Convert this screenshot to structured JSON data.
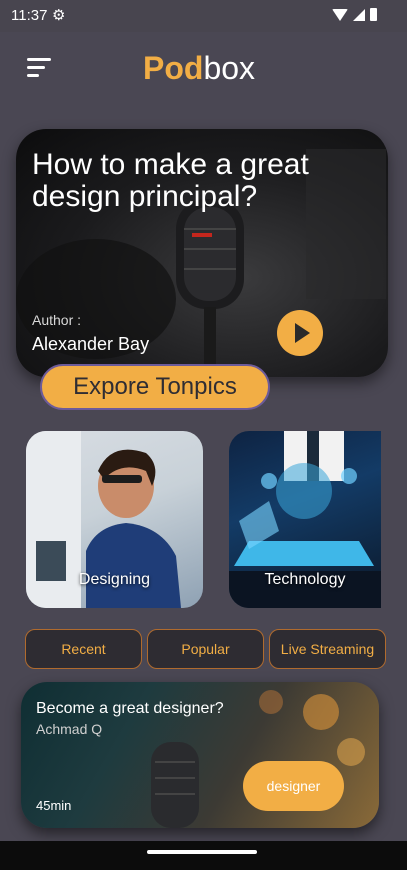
{
  "status_bar": {
    "time": "11:37",
    "settings_icon": "gear-icon",
    "wifi_icon": "wifi-icon",
    "signal_icon": "signal-icon",
    "battery_icon": "battery-icon"
  },
  "header": {
    "menu_icon": "menu-icon",
    "logo_part1": "Pod",
    "logo_part2": "box"
  },
  "featured": {
    "title": "How to make a great design principal?",
    "author_label": "Author :",
    "author": "Alexander Bay",
    "play_icon": "play-icon"
  },
  "explore_button": "Expore Tonpics",
  "topics": [
    {
      "label": "Designing"
    },
    {
      "label": "Technology"
    }
  ],
  "tabs": [
    {
      "label": "Recent"
    },
    {
      "label": "Popular"
    },
    {
      "label": "Live Streaming"
    }
  ],
  "podcast": {
    "title": "Become a great designer?",
    "author": "Achmad Q",
    "duration": "45min",
    "tag": "designer"
  },
  "colors": {
    "accent": "#f2ae45",
    "background": "#4a4753",
    "tab_border": "#b06b2e"
  }
}
